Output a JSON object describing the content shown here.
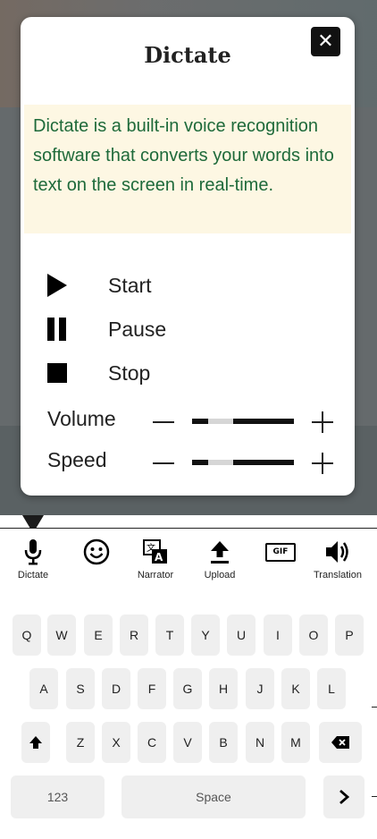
{
  "dialog": {
    "title": "Dictate",
    "close_label": "✕",
    "description": "Dictate is a built-in voice recognition software that converts your words into text on the screen in real-time.",
    "controls": [
      {
        "label": "Start",
        "icon": "play-icon"
      },
      {
        "label": "Pause",
        "icon": "pause-icon"
      },
      {
        "label": "Stop",
        "icon": "stop-icon"
      }
    ],
    "volume_label": "Volume",
    "speed_label": "Speed",
    "volume_level": 0.15,
    "speed_level": 0.15
  },
  "toolbar": {
    "items": [
      {
        "label": "Dictate",
        "icon": "microphone-icon"
      },
      {
        "label": "",
        "icon": "smiley-icon"
      },
      {
        "label": "Narrator",
        "icon": "narrator-icon"
      },
      {
        "label": "Upload",
        "icon": "upload-icon"
      },
      {
        "label": "",
        "icon": "gif-icon",
        "badge": "GIF"
      },
      {
        "label": "Translation",
        "icon": "speaker-icon"
      }
    ]
  },
  "keyboard": {
    "row1": [
      "Q",
      "W",
      "E",
      "R",
      "T",
      "Y",
      "U",
      "I",
      "O",
      "P"
    ],
    "row2": [
      "A",
      "S",
      "D",
      "F",
      "G",
      "H",
      "J",
      "K",
      "L"
    ],
    "row3": [
      "Z",
      "X",
      "C",
      "V",
      "B",
      "N",
      "M"
    ],
    "numbers_label": "123",
    "space_label": "Space",
    "shift_icon": "shift-arrow-icon",
    "backspace_icon": "backspace-icon",
    "enter_icon": "chevron-right-icon"
  },
  "colors": {
    "description_bg": "#fdf7e3",
    "description_text": "#1e6a3a",
    "key_bg": "#efefef",
    "overlay": "#656a6c"
  }
}
